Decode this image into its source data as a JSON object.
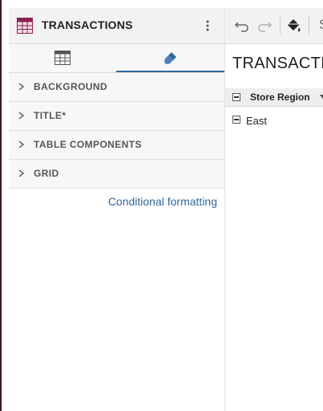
{
  "panel": {
    "title": "TRANSACTIONS",
    "tabs": [
      {
        "name": "table-layout",
        "icon": "table-grid-icon",
        "active": false
      },
      {
        "name": "format",
        "icon": "paint-brush-icon",
        "active": true
      }
    ],
    "sections": [
      {
        "label": "BACKGROUND"
      },
      {
        "label": "TITLE*"
      },
      {
        "label": "TABLE COMPONENTS"
      },
      {
        "label": "GRID"
      }
    ],
    "conditional_formatting_label": "Conditional formatting"
  },
  "toolbar": {
    "icons": [
      "undo-icon",
      "redo-icon",
      "paint-bucket-icon"
    ],
    "truncated_text": "S"
  },
  "main": {
    "title": "TRANSACTIONS",
    "column_header": "Store Region",
    "rows": [
      {
        "label": "East"
      }
    ]
  },
  "colors": {
    "accent": "#2d6a9c",
    "table_icon": "#8b2252",
    "header_bg": "#f2f2f2"
  }
}
